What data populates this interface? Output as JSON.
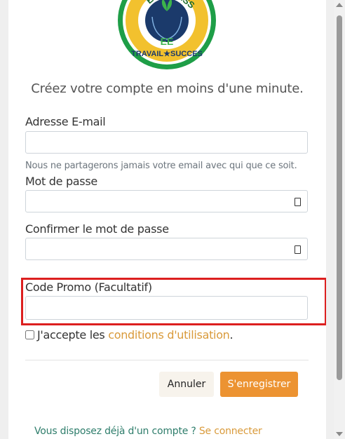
{
  "logo": {
    "top_text": "EPR",
    "top_text_right": "ESS",
    "bottom_text": "TRAVAIL★SUCCES",
    "initials": "EE"
  },
  "subtitle": "Créez votre compte en moins d'une minute.",
  "email": {
    "label": "Adresse E-mail",
    "value": "",
    "help": "Nous ne partagerons jamais votre email avec qui que ce soit."
  },
  "password": {
    "label": "Mot de passe",
    "value": ""
  },
  "confirm_password": {
    "label": "Confirmer le mot de passe",
    "value": ""
  },
  "promo": {
    "label": "Code Promo (Facultatif)",
    "value": ""
  },
  "terms": {
    "prefix": "J'accepte les ",
    "link": "conditions d'utilisation",
    "suffix": "."
  },
  "buttons": {
    "cancel": "Annuler",
    "register": "S'enregistrer"
  },
  "login": {
    "prompt": "Vous disposez déjà d'un compte ? ",
    "link": "Se connecter"
  },
  "colors": {
    "accent": "#ec9332",
    "link": "#d99a3a",
    "highlight_border": "#dc1f1f",
    "logo_green": "#1e9e47",
    "logo_gold": "#f2c12e",
    "logo_navy": "#1b3a6b"
  }
}
